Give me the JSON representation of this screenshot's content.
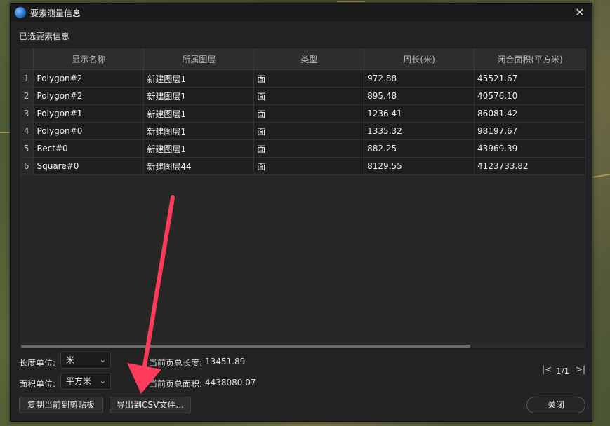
{
  "dialog": {
    "title": "要素测量信息",
    "close_icon": "close-icon",
    "section_label": "已选要素信息"
  },
  "table": {
    "columns": [
      "显示名称",
      "所属图层",
      "类型",
      "周长(米)",
      "闭合面积(平方米)"
    ],
    "rows": [
      {
        "index": "1",
        "name": "Polygon#2",
        "layer": "新建图层1",
        "type": "面",
        "perimeter": "972.88",
        "area": "45521.67"
      },
      {
        "index": "2",
        "name": "Polygon#2",
        "layer": "新建图层1",
        "type": "面",
        "perimeter": "895.48",
        "area": "40576.10"
      },
      {
        "index": "3",
        "name": "Polygon#1",
        "layer": "新建图层1",
        "type": "面",
        "perimeter": "1236.41",
        "area": "86081.42"
      },
      {
        "index": "4",
        "name": "Polygon#0",
        "layer": "新建图层1",
        "type": "面",
        "perimeter": "1335.32",
        "area": "98197.67"
      },
      {
        "index": "5",
        "name": "Rect#0",
        "layer": "新建图层1",
        "type": "面",
        "perimeter": "882.25",
        "area": "43969.39"
      },
      {
        "index": "6",
        "name": "Square#0",
        "layer": "新建图层44",
        "type": "面",
        "perimeter": "8129.55",
        "area": "4123733.82"
      }
    ]
  },
  "units": {
    "length_label": "长度单位:",
    "length_value": "米",
    "area_label": "面积单位:",
    "area_value": "平方米"
  },
  "summary": {
    "total_length_label": "当前页总长度:",
    "total_length_value": "13451.89",
    "total_area_label": "当前页总面积:",
    "total_area_value": "4438080.07"
  },
  "pager": {
    "first_icon": "first-page-icon",
    "last_icon": "last-page-icon",
    "page_text": "1/1"
  },
  "buttons": {
    "copy_label": "复制当前到剪贴板",
    "export_label": "导出到CSV文件...",
    "close_label": "关闭"
  },
  "annotation": {
    "arrow_color": "#ff3b5c"
  }
}
